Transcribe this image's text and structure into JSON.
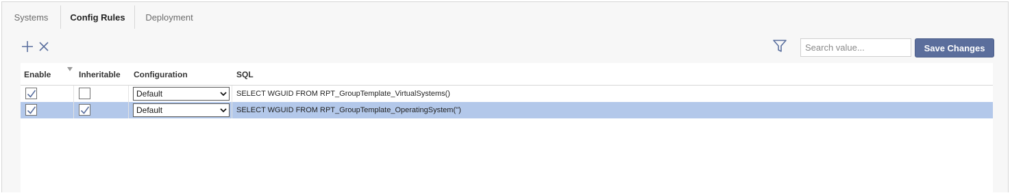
{
  "tabs": [
    {
      "label": "Systems",
      "active": false
    },
    {
      "label": "Config Rules",
      "active": true
    },
    {
      "label": "Deployment",
      "active": false
    }
  ],
  "toolbar": {
    "add_icon": "plus-icon",
    "delete_icon": "close-icon",
    "filter_icon": "filter-icon",
    "search_placeholder": "Search value...",
    "search_value": "",
    "save_label": "Save Changes"
  },
  "columns": {
    "enable": "Enable",
    "inheritable": "Inheritable",
    "configuration": "Configuration",
    "sql": "SQL"
  },
  "rows": [
    {
      "enable": true,
      "inheritable": false,
      "configuration": "Default",
      "sql": "SELECT WGUID FROM RPT_GroupTemplate_VirtualSystems()",
      "selected": false
    },
    {
      "enable": true,
      "inheritable": true,
      "configuration": "Default",
      "sql": "SELECT WGUID FROM RPT_GroupTemplate_OperatingSystem('')",
      "selected": true
    }
  ],
  "colors": {
    "accent": "#5b6e9c",
    "selected_row": "#b3c8ea",
    "check": "#5a6f9e"
  }
}
